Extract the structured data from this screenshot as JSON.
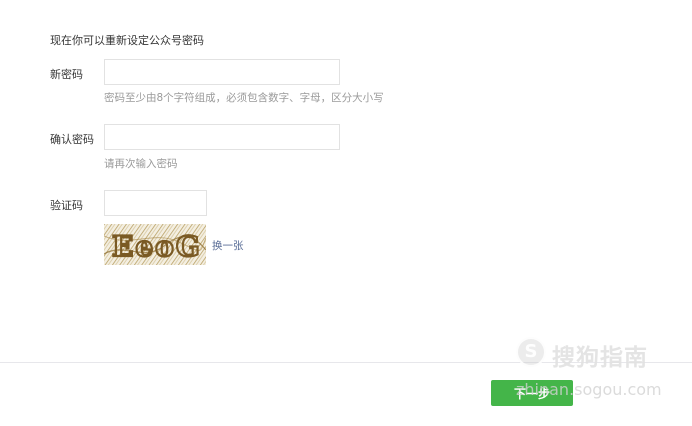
{
  "intro": "现在你可以重新设定公众号密码",
  "fields": {
    "new_password": {
      "label": "新密码",
      "value": "",
      "hint": "密码至少由8个字符组成，必须包含数字、字母，区分大小写"
    },
    "confirm_password": {
      "label": "确认密码",
      "value": "",
      "hint": "请再次输入密码"
    },
    "captcha": {
      "label": "验证码",
      "value": "",
      "image_text": "EeoG",
      "refresh_label": "换一张"
    }
  },
  "actions": {
    "next_label": "下一步"
  },
  "watermark": {
    "logo": "S",
    "brand": "搜狗指南",
    "url": "zhinan.sogou.com"
  },
  "colors": {
    "primary_button": "#44b549",
    "link": "#576b95",
    "hint_text": "#9a9a9a",
    "input_border": "#e2e2e2",
    "captcha_ink": "#9a7a3a"
  }
}
